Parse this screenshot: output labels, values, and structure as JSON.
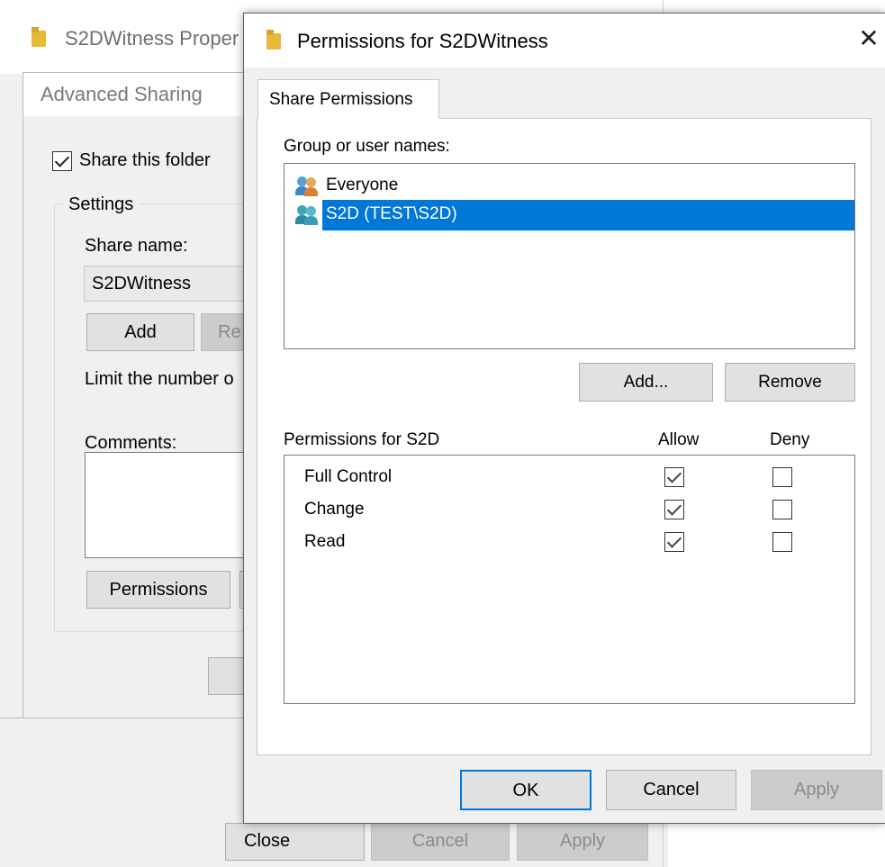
{
  "properties_window": {
    "title": "S2DWitness Proper",
    "buttons": {
      "close": "Close",
      "cancel": "Cancel",
      "apply": "Apply"
    }
  },
  "advanced_sharing": {
    "title": "Advanced Sharing",
    "share_checkbox_label": "Share this folder",
    "share_checked": true,
    "settings_group": "Settings",
    "share_name_label": "Share name:",
    "share_name_value": "S2DWitness",
    "add_button": "Add",
    "remove_button": "Re",
    "limit_label": "Limit the number o",
    "comments_label": "Comments:",
    "permissions_button": "Permissions"
  },
  "permissions_dialog": {
    "title": "Permissions for S2DWitness",
    "tab": "Share Permissions",
    "group_label": "Group or user names:",
    "users": [
      {
        "name": "Everyone",
        "icon": "users-group-icon",
        "selected": false
      },
      {
        "name": "S2D (TEST\\S2D)",
        "icon": "users-group-icon",
        "selected": true
      }
    ],
    "add_button": "Add...",
    "remove_button": "Remove",
    "permissions_label": "Permissions for S2D",
    "allow_header": "Allow",
    "deny_header": "Deny",
    "permissions": [
      {
        "name": "Full Control",
        "allow": true,
        "deny": false
      },
      {
        "name": "Change",
        "allow": true,
        "deny": false
      },
      {
        "name": "Read",
        "allow": true,
        "deny": false
      }
    ],
    "buttons": {
      "ok": "OK",
      "cancel": "Cancel",
      "apply": "Apply"
    },
    "colors": {
      "selection": "#0078d7",
      "default_button_border": "#0078d7"
    }
  }
}
